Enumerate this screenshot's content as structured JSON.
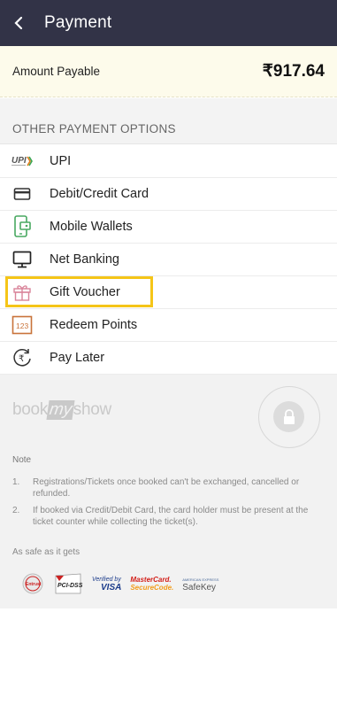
{
  "header": {
    "title": "Payment"
  },
  "amount": {
    "label": "Amount Payable",
    "value": "₹917.64"
  },
  "section_title": "OTHER PAYMENT OPTIONS",
  "options": [
    {
      "label": "UPI",
      "icon": "upi-icon"
    },
    {
      "label": "Debit/Credit Card",
      "icon": "card-icon"
    },
    {
      "label": "Mobile Wallets",
      "icon": "mobile-wallet-icon"
    },
    {
      "label": "Net Banking",
      "icon": "monitor-icon"
    },
    {
      "label": "Gift Voucher",
      "icon": "gift-icon",
      "highlighted": true
    },
    {
      "label": "Redeem Points",
      "icon": "points-icon"
    },
    {
      "label": "Pay Later",
      "icon": "pay-later-icon"
    }
  ],
  "footer": {
    "brand_book": "book",
    "brand_my": "my",
    "brand_show": "show",
    "note_title": "Note",
    "notes": [
      {
        "num": "1.",
        "text": "Registrations/Tickets once booked can't be exchanged, cancelled or refunded."
      },
      {
        "num": "2.",
        "text": "If booked via Credit/Debit Card, the card holder must be present at the ticket counter while collecting the ticket(s)."
      }
    ],
    "safe_label": "As safe as it gets",
    "badges": {
      "entrust": "Entrust",
      "pci": "PCI-DSS",
      "visa_small": "Verified by",
      "visa_big": "VISA",
      "mc_top": "MasterCard.",
      "mc_bottom": "SecureCode.",
      "amex_small": "AMERICAN EXPRESS",
      "amex_big": "SafeKey"
    }
  },
  "colors": {
    "header_bg": "#323347",
    "highlight": "#f5c518",
    "amount_bg": "#fdfbeb"
  }
}
